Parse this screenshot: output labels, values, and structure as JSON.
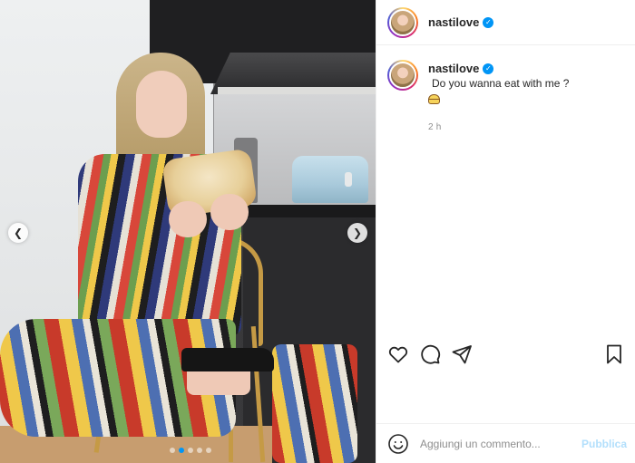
{
  "post": {
    "username": "nastilove",
    "caption": "Do you wanna eat with me ?",
    "time_ago": "2 h",
    "image_dots": 5,
    "active_dot": 1
  },
  "icons": {
    "nav_prev": "chevron-left-icon",
    "nav_next": "chevron-right-icon",
    "like": "heart-icon",
    "comment": "comment-bubble-icon",
    "share": "paper-plane-icon",
    "save": "bookmark-icon",
    "emoji": "smiley-icon",
    "verified": "verified-badge-icon"
  },
  "comment_box": {
    "placeholder": "Aggiungi un commento...",
    "publish_label": "Pubblica"
  },
  "colors": {
    "verified": "#0095f6",
    "publish_disabled": "#b2dffc",
    "secondary_text": "#8e8e8e"
  }
}
